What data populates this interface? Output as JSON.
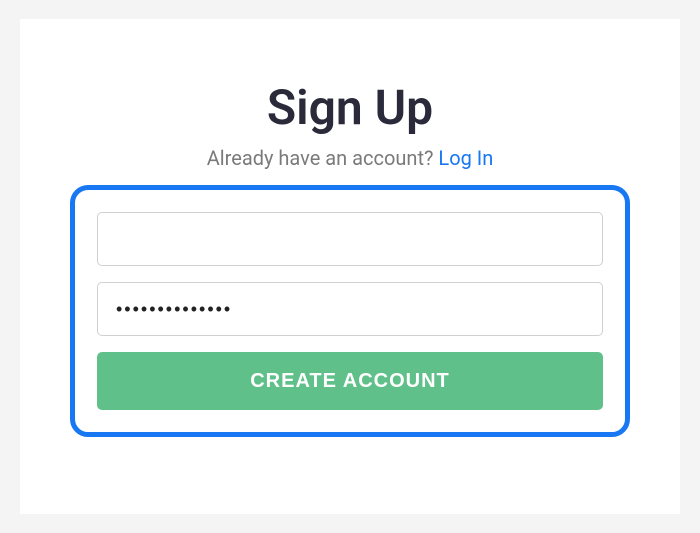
{
  "title": "Sign Up",
  "subtext": "Already have an account? ",
  "login_link": "Log In",
  "form": {
    "email_value": "",
    "password_value": "••••••••••••••",
    "submit_label": "CREATE ACCOUNT"
  }
}
